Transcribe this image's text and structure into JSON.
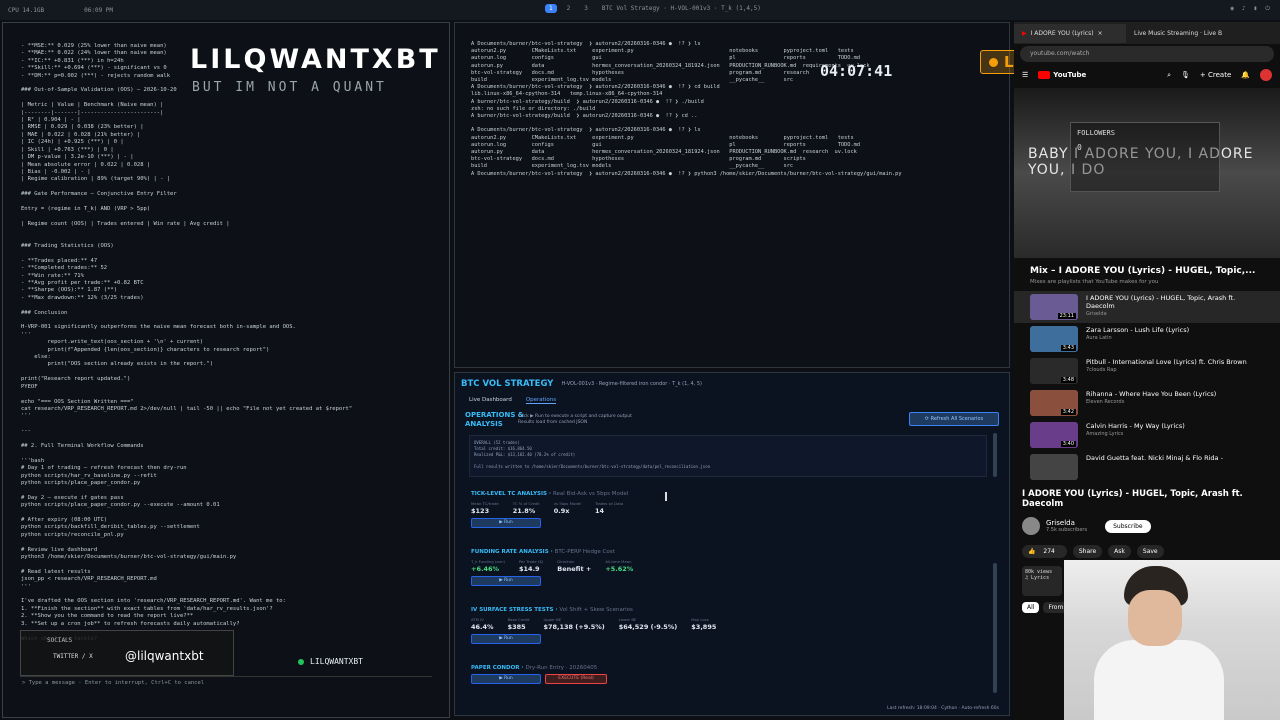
{
  "topbar": {
    "left1": "CPU 14.1GB",
    "left2": "06:09 PM",
    "workspaces": [
      "1",
      "2",
      "3"
    ],
    "window_title": "BTC Vol Strategy · H-VOL-001v3 · T_k (1,4,5)"
  },
  "overlay": {
    "title": "LILQWANTXBT",
    "subtitle": "BUT IM NOT A QUANT",
    "clock": "04:07:41",
    "live": "LIVE"
  },
  "left_terminal": {
    "lines": [
      "- **MSE:** 0.029 (25% lower than naive mean)",
      "- **MAE:** 0.022 (24% lower than naive mean)",
      "- **IC:** +0.831 (***) in h=24h",
      "- **Skill:** +0.694 (***) - significant vs 0",
      "- **DM:** p=0.002 (***) - rejects random walk",
      "",
      "### Out-of-Sample Validation (OOS) — 2026-10-20",
      "",
      "| Metric | Value | Benchmark (Naive mean) |",
      "|--------|-------|------------------------|",
      "| R² | 0.904 | - |",
      "| RMSE | 0.029 | 0.038 (23% better) |",
      "| MAE | 0.022 | 0.028 (21% better) |",
      "| IC (24h) | +0.925 (***) | 0 |",
      "| Skill | +0.763 (***) | 0 |",
      "| DM p-value | 3.2e-10 (***) | - |",
      "| Mean absolute error | 0.022 | 0.028 |",
      "| Bias | -0.002 | - |",
      "| Regime calibration | 89% (target 90%) | - |",
      "",
      "### Gate Performance — Conjunctive Entry Filter",
      "",
      "Entry = (regime in T_k) AND (VRP > 5pp)",
      "",
      "| Regime count (OOS) | Trades entered | Win rate | Avg credit |",
      "",
      "",
      "### Trading Statistics (OOS)",
      "",
      "- **Trades placed:** 47",
      "- **Completed trades:** 52",
      "- **Win rate:** 71%",
      "- **Avg profit per trade:** +0.82 BTC",
      "- **Sharpe (OOS):** 1.87 (**)",
      "- **Max drawdown:** 12% (3/25 trades)",
      "",
      "### Conclusion",
      "",
      "H-VRP-001 significantly outperforms the naive mean forecast both in-sample and OOS.",
      "'''",
      "        report.write_text(oos_section + '\\n' + current)",
      "        print(f\"Appended {len(oos_section)} characters to research report\")",
      "    else:",
      "        print(\"OOS section already exists in the report.\")",
      "",
      "print(\"Research report updated.\")",
      "PYEOF",
      "",
      "echo \"=== OOS Section Written ===\"",
      "cat research/VRP_RESEARCH_REPORT.md 2>/dev/null | tail -50 || echo \"File not yet created at $report\"",
      "'''",
      "",
      "---",
      "",
      "## 2. Full Terminal Workflow Commands",
      "",
      "'''bash",
      "# Day 1 of trading — refresh forecast then dry-run",
      "python scripts/har_rv_baseline.py --refit",
      "python scripts/place_paper_condor.py",
      "",
      "# Day 2 — execute if gates pass",
      "python scripts/place_paper_condor.py --execute --amount 0.01",
      "",
      "# After expiry (08:00 UTC)",
      "python scripts/backfill_deribit_tables.py --settlement",
      "python scripts/reconcile_pnl.py",
      "",
      "# Review live dashboard",
      "python3 /home/skier/Documents/burner/btc-vol-strategy/gui/main.py",
      "",
      "# Read latest results",
      "json_pp < research/VRP_RESEARCH_REPORT.md",
      "'''",
      "",
      "I've drafted the OOS section into 'research/VRP_RESEARCH_REPORT.md'. Want me to:",
      "1. **Finish the section** with exact tables from 'data/har_rv_results.json'?",
      "2. **Show you the command to read the report live?**",
      "3. **Set up a cron job** to refresh forecasts daily automatically?",
      "",
      "Which should we tackle?"
    ],
    "prompt_placeholder": "> Type a message · Enter to interrupt, Ctrl+C to cancel"
  },
  "socials": {
    "label": "SOCIALS",
    "platform": "TWITTER / X",
    "handle": "@lilqwantxbt",
    "brand": "LILQWANTXBT"
  },
  "top_terminal": {
    "lines": [
      "A Documents/burner/btc-vol-strategy  ❯ autorun2/20260316-0346 ●  !? ❯ ls",
      "autorun2.py        CMakeLists.txt     experiment.py                              notebooks        pyproject.toml   tests",
      "autorun.log        configs            gui                                        pl               reports          TODO.md",
      "autorun.py         data               hermes_conversation_20260324_181924.json   PRODUCTION_RUNBOOK.md  requirements  uv.lock",
      "btc-vol-strategy   docs.md            hypotheses                                 program.md       research",
      "build              experiment_log.tsv models                                     __pycache__      src",
      "A Documents/burner/btc-vol-strategy  ❯ autorun2/20260316-0346 ●  !? ❯ cd build",
      "lib.linux-x86_64-cpython-314   temp.linux-x86_64-cpython-314",
      "A burner/btc-vol-strategy/build  ❯ autorun2/20260316-0346 ●  !? ❯ ./build",
      "zsh: no such file or directory: ./build",
      "A burner/btc-vol-strategy/build  ❯ autorun2/20260316-0346 ●  !? ❯ cd ..",
      "",
      "A Documents/burner/btc-vol-strategy  ❯ autorun2/20260316-0346 ●  !? ❯ ls",
      "autorun2.py        CMakeLists.txt     experiment.py                              notebooks        pyproject.toml   tests",
      "autorun.log        configs            gui                                        pl               reports          TODO.md",
      "autorun.py         data               hermes_conversation_20260324_181924.json   PRODUCTION_RUNBOOK.md  research  uv.lock",
      "btc-vol-strategy   docs.md            hypotheses                                 program.md       scripts",
      "build              experiment_log.tsv models                                     __pycache__      src",
      "A Documents/burner/btc-vol-strategy  ❯ autorun2/20260316-0346 ●  !? ❯ python3 /home/skier/Documents/burner/btc-vol-strategy/gui/main.py"
    ]
  },
  "dashboard": {
    "title": "BTC VOL STRATEGY",
    "meta": "H-VOL-001v3 · Regime-filtered iron condor · T_k (1, 4, 5)",
    "tabs": [
      "Live Dashboard",
      "Operations"
    ],
    "ops_title_1": "OPERATIONS &",
    "ops_title_2": "ANALYSIS",
    "ops_note_1": "Click ▶ Run to execute a script and capture output",
    "ops_note_2": "Results load from cached JSON",
    "refresh": "⟳ Refresh All Scenarios",
    "results": [
      "OVERALL (52 trades)",
      "  Total credit: $16,864.50",
      "  Realized P&L: $13,182.40 (78.2% of credit)",
      "",
      "Full results written to /home/skier/Documents/burner/btc-vol-strategy/data/pnl_reconciliation.json"
    ],
    "sections": [
      {
        "title": "TICK-LEVEL TC ANALYSIS",
        "subtitle": "Real Bid-Ask vs 5bps Model",
        "metrics": [
          {
            "k": "Mean TC/trade",
            "v": "$123"
          },
          {
            "k": "TC % of Credit",
            "v": "21.8%"
          },
          {
            "k": "vs 5bps Model",
            "v": "0.9x"
          },
          {
            "k": "Trades w/ Data",
            "v": "14"
          }
        ],
        "run": "▶ Run"
      },
      {
        "title": "FUNDING RATE ANALYSIS",
        "subtitle": "BTC-PERP Hedge Cost",
        "metrics": [
          {
            "k": "T_k Funding (ann)",
            "v": "+6.46%"
          },
          {
            "k": "Per Trade ($)",
            "v": "$14.9"
          },
          {
            "k": "Direction",
            "v": "Benefit +"
          },
          {
            "k": "All-time Mean",
            "v": "+5.62%"
          }
        ],
        "run": "▶ Run"
      },
      {
        "title": "IV SURFACE STRESS TESTS",
        "subtitle": "Vol Shift + Skew Scenarios",
        "metrics": [
          {
            "k": "ATM IV",
            "v": "46.4%"
          },
          {
            "k": "Base Credit",
            "v": "$385"
          },
          {
            "k": "Upper BE",
            "v": "$78,138 (+9.5%)"
          },
          {
            "k": "Lower BE",
            "v": "$64,529 (-9.5%)"
          },
          {
            "k": "Max Loss",
            "v": "$3,895"
          }
        ],
        "run": "▶ Run"
      },
      {
        "title": "PAPER CONDOR",
        "subtitle": "Dry-Run Entry · 20260405",
        "metrics": [],
        "run": "▶ Run",
        "execute": "EXECUTE (Real)"
      }
    ],
    "footer": "Last refresh: 18:09:04 · Cython · Auto-refresh 60s"
  },
  "youtube": {
    "tab_active": "I ADORE YOU (Lyrics)",
    "tab_2": "Live Music Streaming · Live B",
    "url": "youtube.com/watch",
    "logo": "YouTube",
    "create": "+ Create",
    "lyric": "BABY I ADORE YOU, I ADORE YOU, I DO",
    "followers_label": "FOLLOWERS",
    "followers_count": "0",
    "mix_title": "Mix – I ADORE YOU (Lyrics) - HUGEL, Topic,...",
    "mix_sub": "Mixes are playlists that YouTube makes for you",
    "playlist": [
      {
        "title": "I ADORE YOU (Lyrics) - HUGEL, Topic, Arash ft. Daecolm",
        "artist": "Griselda",
        "dur": "23:11"
      },
      {
        "title": "Zara Larsson - Lush Life (Lyrics)",
        "artist": "Aura Latin",
        "dur": "3:43"
      },
      {
        "title": "Pitbull - International Love (Lyrics) ft. Chris Brown",
        "artist": "7clouds Rap",
        "dur": "3:48"
      },
      {
        "title": "Rihanna - Where Have You Been (Lyrics)",
        "artist": "Eleven Records",
        "dur": "3:42"
      },
      {
        "title": "Calvin Harris - My Way (Lyrics)",
        "artist": "Amazing Lyrics",
        "dur": "3:40"
      },
      {
        "title": "David Guetta feat. Nicki Minaj & Flo Rida -",
        "artist": "",
        "dur": ""
      }
    ],
    "video_title": "I ADORE YOU (Lyrics) - HUGEL, Topic, Arash ft. Daecolm",
    "channel": "Griselda",
    "channel_subs": "7.5k subscribers",
    "subscribe": "Subscribe",
    "likes": "274",
    "share": "Share",
    "ask": "Ask",
    "save": "Save",
    "views": "80k views",
    "desc_tag": "♫ Lyrics",
    "chip_all": "All",
    "chip_from": "From"
  },
  "colors": {
    "accent": "#38bdf8",
    "live": "#f59e0b",
    "yt_red": "#ff0000"
  }
}
